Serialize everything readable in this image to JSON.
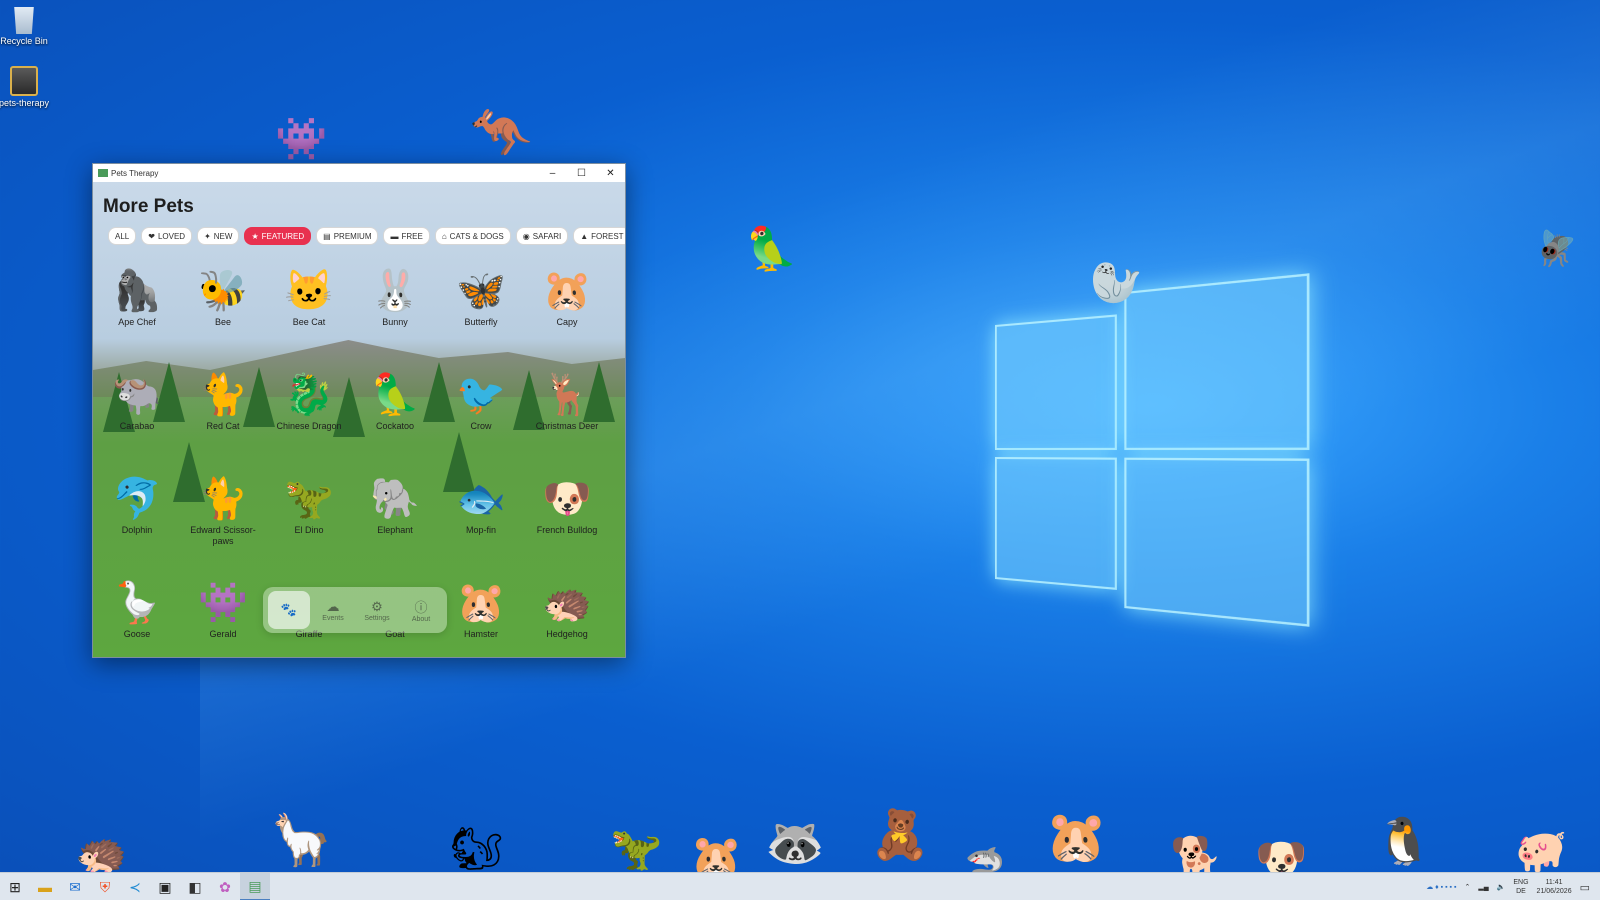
{
  "desktop": {
    "icons": [
      {
        "label": "Recycle Bin",
        "icon": "recycle-bin-icon"
      },
      {
        "label": "pets-therapy",
        "icon": "app-shortcut-icon"
      }
    ]
  },
  "window": {
    "title": "Pets Therapy",
    "controls": {
      "minimize": "–",
      "maximize": "☐",
      "close": "✕"
    },
    "heading": "More Pets",
    "filters": [
      {
        "label": "ALL",
        "icon": ""
      },
      {
        "label": "LOVED",
        "icon": "❤"
      },
      {
        "label": "NEW",
        "icon": "✦"
      },
      {
        "label": "FEATURED",
        "icon": "★"
      },
      {
        "label": "PREMIUM",
        "icon": "▤"
      },
      {
        "label": "FREE",
        "icon": "▬"
      },
      {
        "label": "CATS & DOGS",
        "icon": "⌂"
      },
      {
        "label": "SAFARI",
        "icon": "◉"
      },
      {
        "label": "FOREST",
        "icon": "▲"
      }
    ],
    "active_filter": "FEATURED",
    "pets": [
      {
        "name": "Ape Chef",
        "glyph": "🦍"
      },
      {
        "name": "Bee",
        "glyph": "🐝"
      },
      {
        "name": "Bee Cat",
        "glyph": "🐱"
      },
      {
        "name": "Bunny",
        "glyph": "🐰"
      },
      {
        "name": "Butterfly",
        "glyph": "🦋"
      },
      {
        "name": "Capy",
        "glyph": "🐹"
      },
      {
        "name": "Carabao",
        "glyph": "🐃"
      },
      {
        "name": "Red Cat",
        "glyph": "🐈"
      },
      {
        "name": "Chinese Dragon",
        "glyph": "🐉"
      },
      {
        "name": "Cockatoo",
        "glyph": "🦜"
      },
      {
        "name": "Crow",
        "glyph": "🐦"
      },
      {
        "name": "Christmas Deer",
        "glyph": "🦌"
      },
      {
        "name": "Dolphin",
        "glyph": "🐬"
      },
      {
        "name": "Edward Scissor-paws",
        "glyph": "🐈"
      },
      {
        "name": "El Dino",
        "glyph": "🦖"
      },
      {
        "name": "Elephant",
        "glyph": "🐘"
      },
      {
        "name": "Mop-fin",
        "glyph": "🐟"
      },
      {
        "name": "French Bulldog",
        "glyph": "🐶"
      },
      {
        "name": "Goose",
        "glyph": "🪿"
      },
      {
        "name": "Gerald",
        "glyph": "👾"
      },
      {
        "name": "Giraffe",
        "glyph": ""
      },
      {
        "name": "Goat",
        "glyph": ""
      },
      {
        "name": "Hamster",
        "glyph": "🐹"
      },
      {
        "name": "Hedgehog",
        "glyph": "🦔"
      }
    ],
    "dock": [
      {
        "label": "",
        "icon": "🐾",
        "name": "pets"
      },
      {
        "label": "Events",
        "icon": "☁",
        "name": "events"
      },
      {
        "label": "Settings",
        "icon": "⚙",
        "name": "settings"
      },
      {
        "label": "About",
        "icon": "ⓘ",
        "name": "about"
      }
    ]
  },
  "taskbar": {
    "tray": {
      "lang": "ENG",
      "region": "DE",
      "time": "11:41",
      "date": "21/06/2026"
    }
  }
}
